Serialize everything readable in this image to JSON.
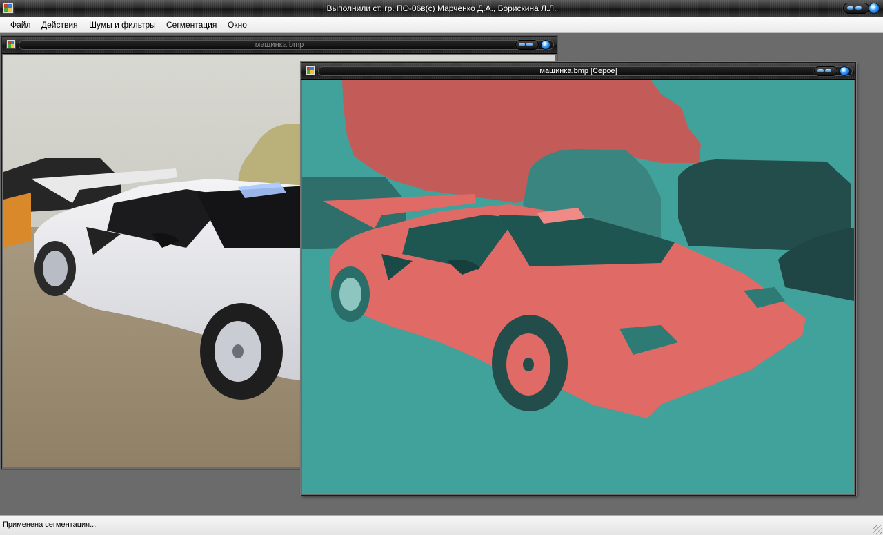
{
  "window": {
    "title": "Выполнили ст. гр. ПО-06в(с) Марченко Д.А., Борискина Л.Л."
  },
  "menu": {
    "items": [
      {
        "label": "Файл"
      },
      {
        "label": "Действия"
      },
      {
        "label": "Шумы и фильтры"
      },
      {
        "label": "Сегментация"
      },
      {
        "label": "Окно"
      }
    ]
  },
  "child_windows": [
    {
      "title": "мащинка.bmp",
      "active": false,
      "image": "white sports car photo"
    },
    {
      "title": "мащинка.bmp [Серое]",
      "active": true,
      "image": "segmented car image, red/teal"
    }
  ],
  "status": {
    "text": "Применена сегментация..."
  },
  "colors": {
    "segment_red": "#d9605c",
    "segment_teal": "#3f9a95",
    "inactive_title_text": "#8a8a8a",
    "active_title_text": "#ffffff"
  }
}
